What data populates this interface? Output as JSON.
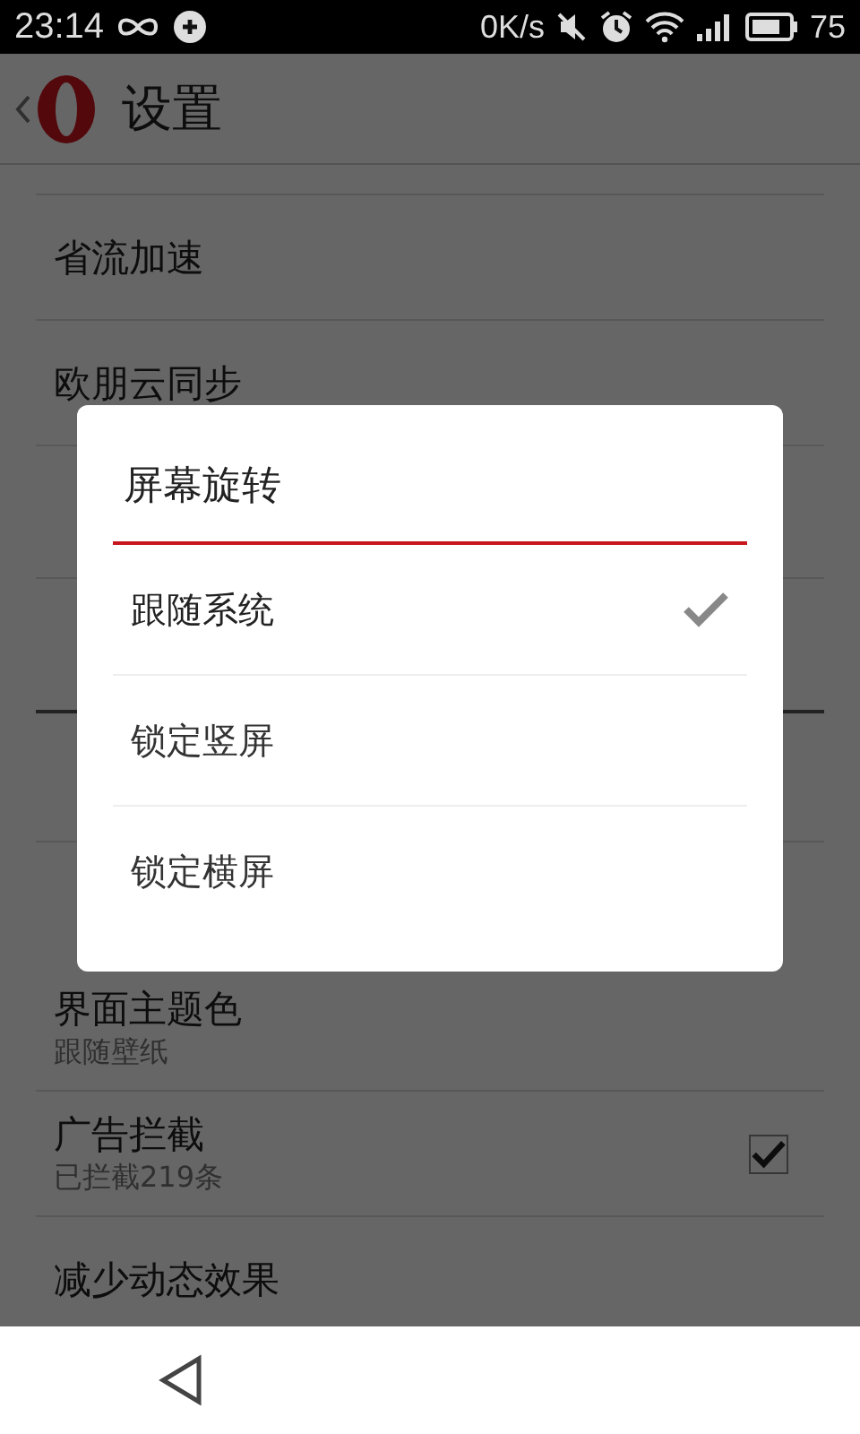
{
  "status_bar": {
    "time": "23:14",
    "speed": "0K/s",
    "battery": "75"
  },
  "header": {
    "title": "设置"
  },
  "settings": [
    {
      "kind": "item",
      "title": "省流加速"
    },
    {
      "kind": "item",
      "title": "欧朋云同步"
    },
    {
      "kind": "gap"
    },
    {
      "kind": "item",
      "title": "界面主题色",
      "subtitle": "跟随壁纸"
    },
    {
      "kind": "check",
      "title": "广告拦截",
      "subtitle": "已拦截219条",
      "checked": true
    },
    {
      "kind": "item",
      "title": "减少动态效果"
    }
  ],
  "dialog": {
    "title": "屏幕旋转",
    "options": [
      {
        "label": "跟随系统",
        "selected": true
      },
      {
        "label": "锁定竖屏",
        "selected": false
      },
      {
        "label": "锁定横屏",
        "selected": false
      }
    ]
  }
}
